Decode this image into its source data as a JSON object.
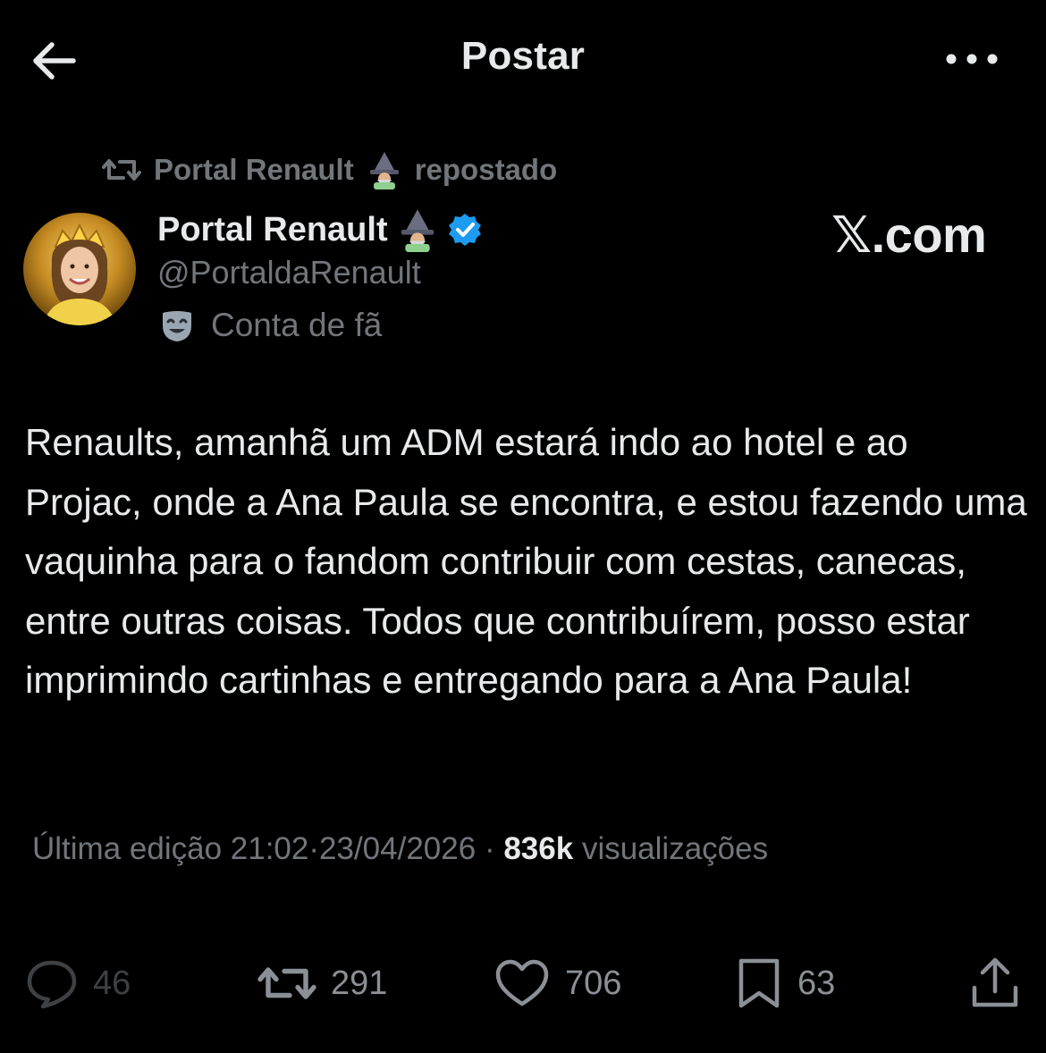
{
  "header": {
    "title": "Postar"
  },
  "repost": {
    "reposter_name": "Portal Renault",
    "label": "repostado"
  },
  "author": {
    "name": "Portal Renault",
    "handle": "@PortaldaRenault",
    "badge": "Conta de fã",
    "verified": true
  },
  "watermark": "𝕏.com",
  "post": {
    "text": "Renaults, amanhã um ADM estará indo ao hotel e ao Projac, onde a Ana Paula se encontra, e estou fazendo uma vaquinha para o fandom contribuir com cestas, canecas, entre outras coisas. Todos que contribuírem, posso estar imprimindo cartinhas e entregando para a Ana Paula!"
  },
  "meta": {
    "edited_label": "Última edição",
    "time": "21:02",
    "separator": "·",
    "date": "23/04/2026",
    "views_count": "836k",
    "views_label": "visualizações"
  },
  "actions": {
    "replies": "46",
    "reposts": "291",
    "likes": "706",
    "bookmarks": "63"
  },
  "icons": {
    "back": "arrow-left-icon",
    "more": "more-horizontal-icon",
    "repost": "repost-icon",
    "verified": "verified-badge-icon",
    "fan": "theater-mask-icon",
    "reply": "reply-bubble-icon",
    "like": "heart-icon",
    "bookmark": "bookmark-icon",
    "share": "share-icon",
    "emoji": "mage-emoji-icon"
  },
  "colors": {
    "background": "#000000",
    "text_primary": "#e7e9ea",
    "text_secondary": "#71767b",
    "verified_blue": "#1d9bf0"
  }
}
